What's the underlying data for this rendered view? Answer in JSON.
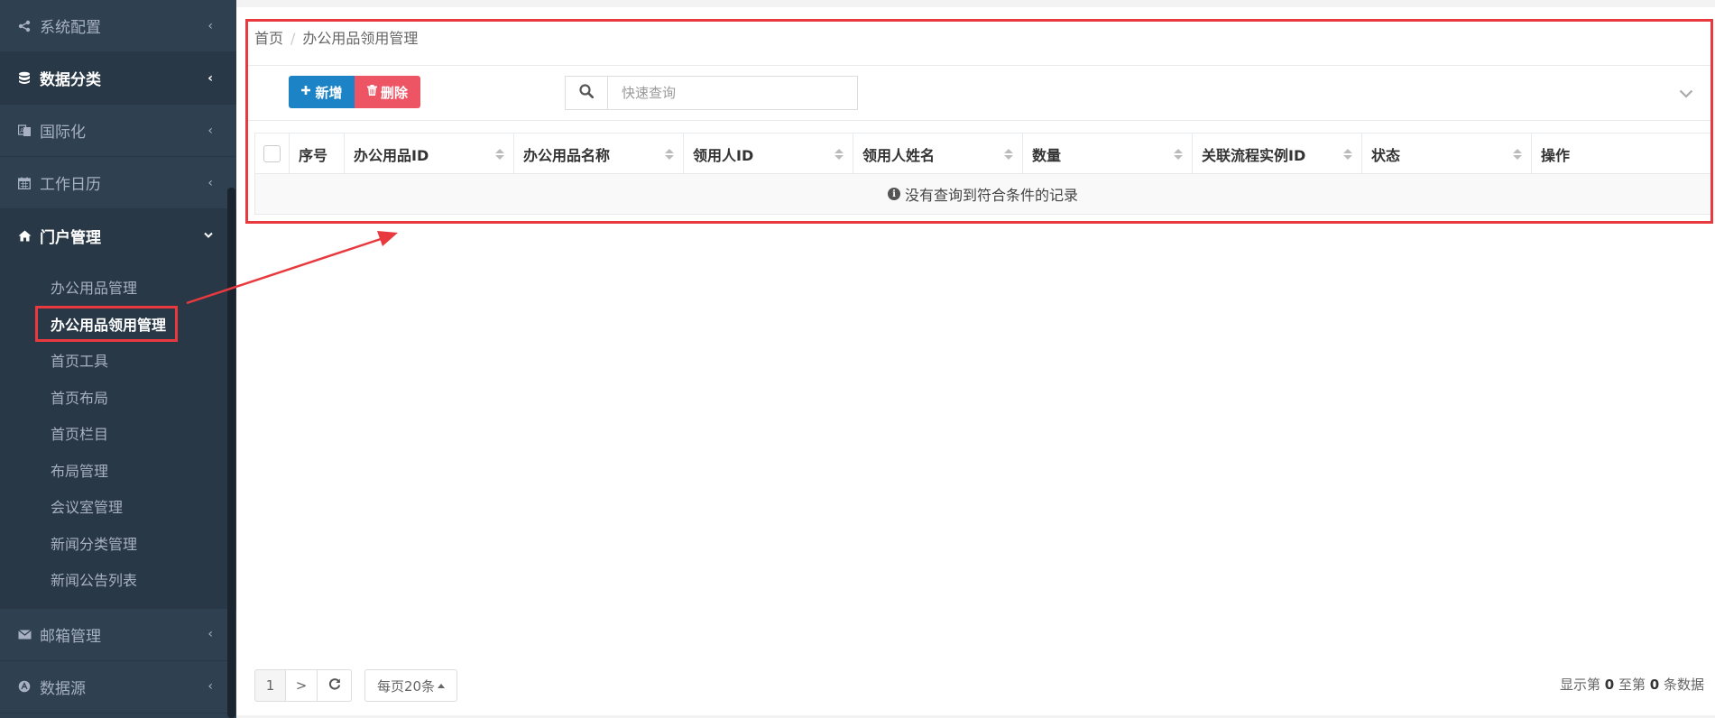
{
  "sidebar": {
    "groups_top": [
      {
        "label": "系统配置",
        "icon": "share-icon"
      },
      {
        "label": "数据分类",
        "icon": "database-icon"
      },
      {
        "label": "国际化",
        "icon": "language-icon"
      },
      {
        "label": "工作日历",
        "icon": "calendar-icon"
      }
    ],
    "open_group": {
      "label": "门户管理",
      "icon": "home-icon"
    },
    "sub_items": [
      "办公用品管理",
      "办公用品领用管理",
      "首页工具",
      "首页布局",
      "首页栏目",
      "布局管理",
      "会议室管理",
      "新闻分类管理",
      "新闻公告列表"
    ],
    "current_sub": "办公用品领用管理",
    "groups_bottom": [
      {
        "label": "邮箱管理",
        "icon": "envelope-icon"
      },
      {
        "label": "数据源",
        "icon": "datasource-icon"
      }
    ]
  },
  "breadcrumb": {
    "home": "首页",
    "sep": "/",
    "current": "办公用品领用管理"
  },
  "toolbar": {
    "add_label": "新增",
    "delete_label": "删除"
  },
  "search": {
    "placeholder": "快速查询"
  },
  "table": {
    "columns": [
      "序号",
      "办公用品ID",
      "办公用品名称",
      "领用人ID",
      "领用人姓名",
      "数量",
      "关联流程实例ID",
      "状态",
      "操作"
    ],
    "empty_text": "没有查询到符合条件的记录"
  },
  "pagination": {
    "page": "1",
    "next": ">",
    "page_size_label": "每页20条",
    "summary_prefix": "显示第",
    "from": "0",
    "summary_mid": "至第",
    "to": "0",
    "summary_suffix": "条数据"
  },
  "colors": {
    "sidebar_bg": "#2f4050",
    "primary": "#1c84c6",
    "danger": "#ed5565",
    "highlight": "#e8393e"
  }
}
